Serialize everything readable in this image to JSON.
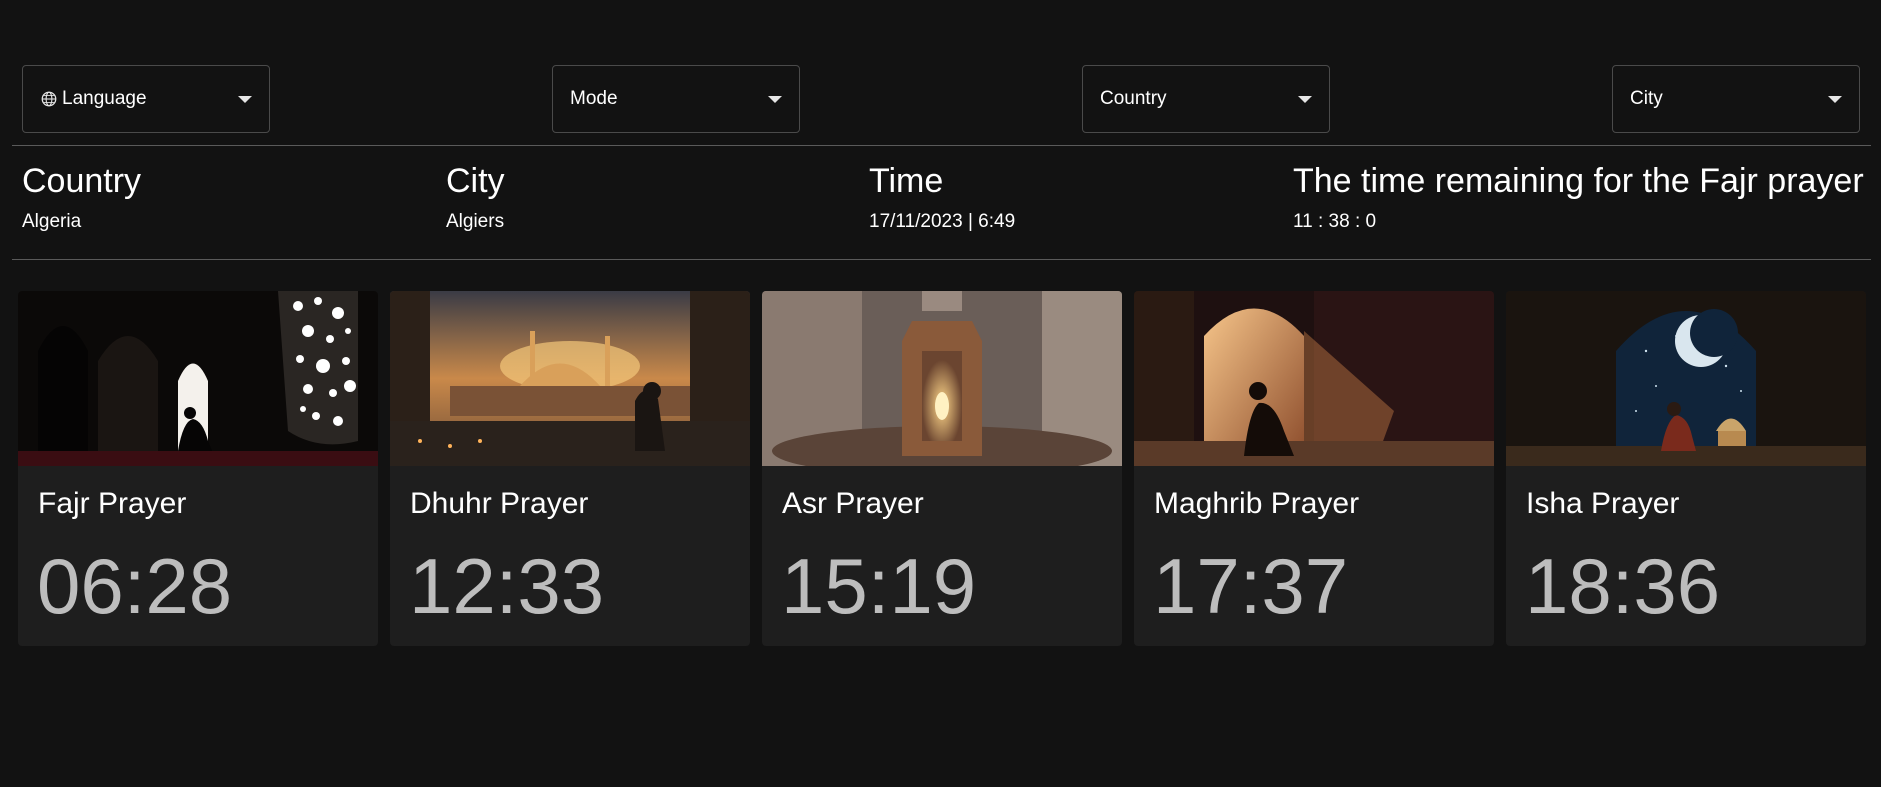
{
  "selects": {
    "language": "Language",
    "mode": "Mode",
    "country": "Country",
    "city": "City"
  },
  "info": {
    "country_heading": "Country",
    "country_value": "Algeria",
    "city_heading": "City",
    "city_value": "Algiers",
    "time_heading": "Time",
    "time_value": "17/11/2023 | 6:49",
    "remaining_heading": "The time remaining for the Fajr prayer",
    "remaining_value": "11 : 38 : 0"
  },
  "prayers": [
    {
      "name": "Fajr Prayer",
      "time": "06:28",
      "image": "man-praying-by-lattice-window"
    },
    {
      "name": "Dhuhr Prayer",
      "time": "12:33",
      "image": "man-overlooking-city-mosque-sunset"
    },
    {
      "name": "Asr Prayer",
      "time": "15:19",
      "image": "ornate-lantern"
    },
    {
      "name": "Maghrib Prayer",
      "time": "17:37",
      "image": "man-praying-in-sunlit-archway"
    },
    {
      "name": "Isha Prayer",
      "time": "18:36",
      "image": "man-under-crescent-moon-archway"
    }
  ],
  "colors": {
    "background": "#121212",
    "card": "#1e1e1e",
    "time_text": "#bdbdbd"
  }
}
